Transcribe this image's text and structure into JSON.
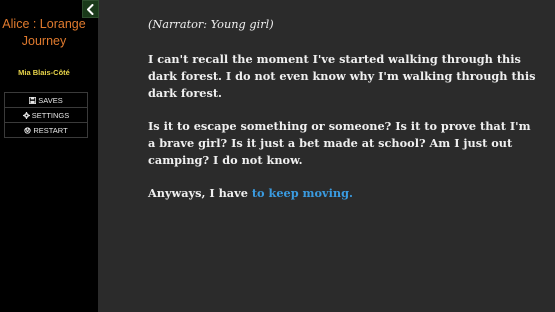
{
  "sidebar": {
    "collapse_icon": "chevron-left-icon",
    "title": "Alice : Lorange Journey",
    "author": "Mia Blais-Côté",
    "menu": [
      {
        "label": "SAVES",
        "icon": "save-icon"
      },
      {
        "label": "SETTINGS",
        "icon": "gear-icon"
      },
      {
        "label": "RESTART",
        "icon": "power-icon"
      }
    ]
  },
  "story": {
    "narrator": "(Narrator: Young girl)",
    "paragraph1": "I can't recall the moment I've started walking through this dark forest. I do not even know why I'm walking through this dark forest.",
    "paragraph2": "Is it to escape something or someone? Is it to prove that I'm a brave girl? Is it just a bet made at school? Am I just out camping? I do not know.",
    "paragraph3_prefix": "Anyways, I have ",
    "paragraph3_link": "to keep moving."
  },
  "colors": {
    "title": "#e07a2e",
    "author": "#e8d44a",
    "link": "#3a9be0",
    "background": "#2b2b2b",
    "sidebar": "#000000"
  }
}
